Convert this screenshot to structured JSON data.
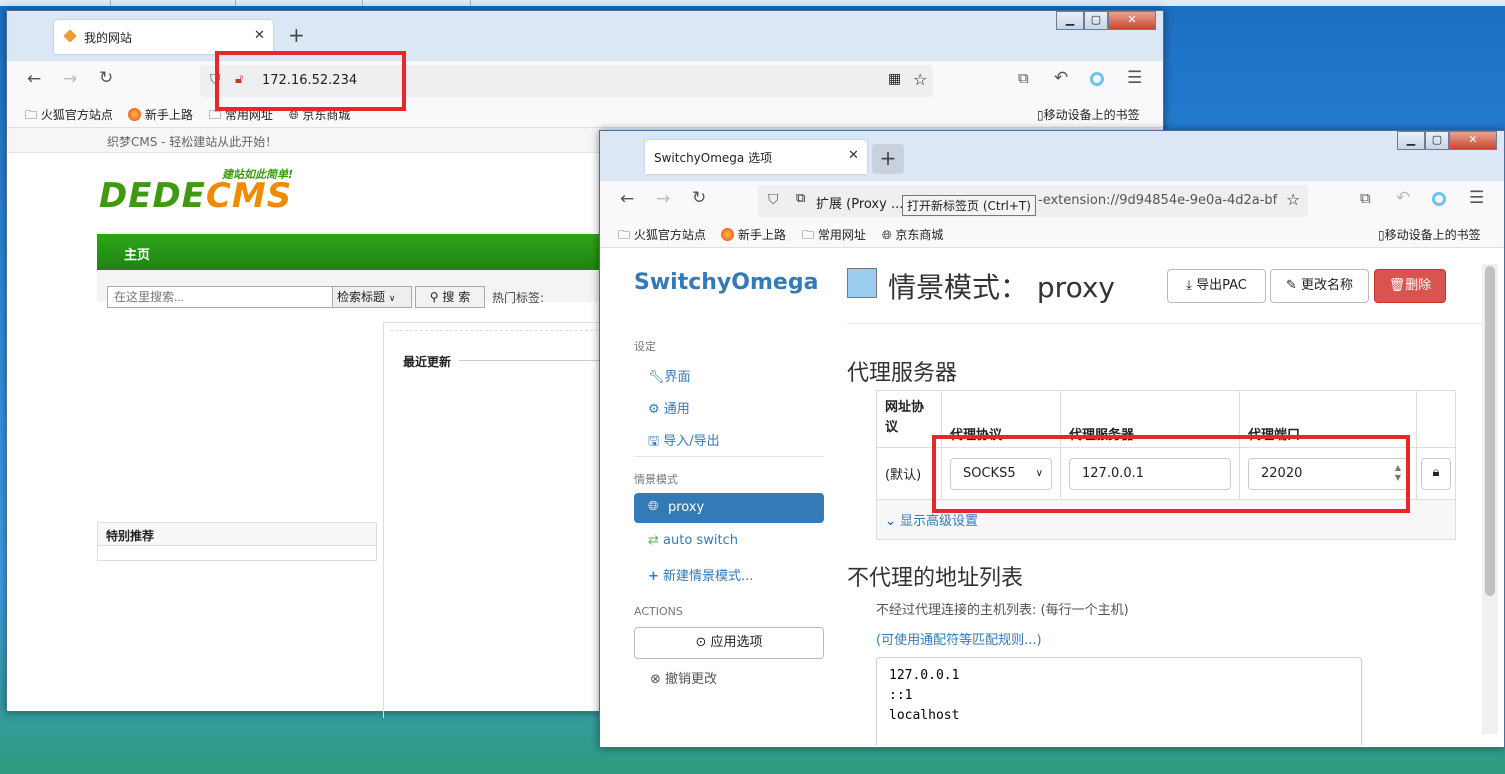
{
  "left_window": {
    "tab_title": "我的网站",
    "url": "172.16.52.234",
    "bookmarks": [
      "火狐官方站点",
      "新手上路",
      "常用网址",
      "京东商城"
    ],
    "bookmarks_right": "移动设备上的书签",
    "site": {
      "subtitle": "织梦CMS - 轻松建站从此开始！",
      "logo_text": "DEDECMS",
      "logo_slogan": "建站如此简单!",
      "nav_home": "主页",
      "search_placeholder": "在这里搜索...",
      "search_select": "检索标题",
      "search_button": "搜 索",
      "hot_tags": "热门标签:",
      "special": "特别推荐",
      "recent": "最近更新"
    }
  },
  "right_window": {
    "tab_title": "SwitchyOmega 选项",
    "url_prefix": "扩展 (Proxy ...",
    "url_rest": "-extension://9d94854e-9e0a-4d2a-bf",
    "tooltip": "打开新标签页 (Ctrl+T)",
    "bookmarks": [
      "火狐官方站点",
      "新手上路",
      "常用网址",
      "京东商城"
    ],
    "bookmarks_right": "移动设备上的书签",
    "app_title": "SwitchyOmega",
    "sidebar": {
      "settings_header": "设定",
      "settings": [
        "界面",
        "通用",
        "导入/导出"
      ],
      "profiles_header": "情景模式",
      "profiles": [
        "proxy",
        "auto switch",
        "新建情景模式..."
      ],
      "actions_header": "ACTIONS",
      "apply": "应用选项",
      "discard": "撤销更改"
    },
    "profile_title": "情景模式： proxy",
    "profile_color": "#99ccee",
    "buttons": {
      "export_pac": "导出PAC",
      "rename": "更改名称",
      "delete": "删除"
    },
    "proxy_section_title": "代理服务器",
    "table": {
      "headers": [
        "网址协议",
        "代理协议",
        "代理服务器",
        "代理端口"
      ],
      "row_label": "(默认)",
      "protocol": "SOCKS5",
      "server": "127.0.0.1",
      "port": "22020",
      "advanced": "显示高级设置"
    },
    "bypass_title": "不代理的地址列表",
    "bypass_desc": "不经过代理连接的主机列表: (每行一个主机)",
    "bypass_link": "(可使用通配符等匹配规则...)",
    "bypass_list": "127.0.0.1\n::1\nlocalhost"
  },
  "colors": {
    "accent_blue": "#337ab7",
    "active_profile": "#337ab7",
    "delete_red": "#d9534f",
    "annotation_red": "#e8262b",
    "dede_green": "#229010"
  }
}
